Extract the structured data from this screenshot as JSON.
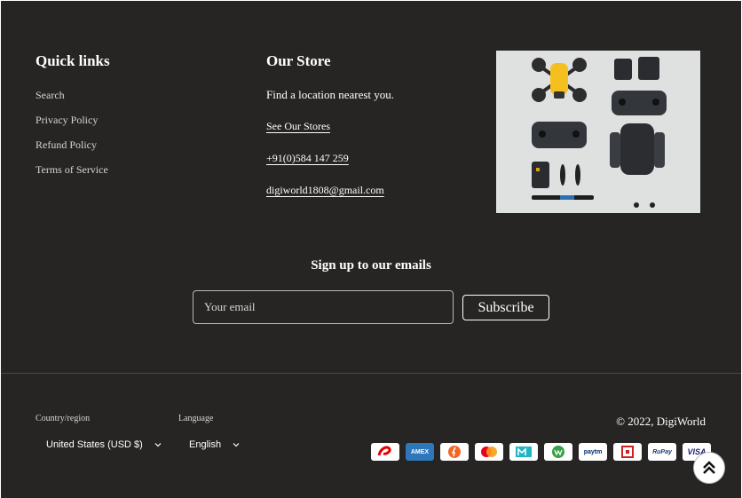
{
  "quick_links": {
    "title": "Quick links",
    "items": [
      {
        "label": "Search"
      },
      {
        "label": "Privacy Policy"
      },
      {
        "label": "Refund Policy"
      },
      {
        "label": "Terms of Service"
      }
    ]
  },
  "store": {
    "title": "Our Store",
    "tagline": "Find a location nearest you.",
    "stores_link": "See Our Stores",
    "phone": "+91(0)584 147 259",
    "email": "digiworld1808@gmail.com"
  },
  "image": {
    "icon": "drone-kit-photo"
  },
  "newsletter": {
    "title": "Sign up to our emails",
    "email_placeholder": "Your email",
    "subscribe_label": "Subscribe"
  },
  "localization": {
    "country_label": "Country/region",
    "country_value": "United States (USD $)",
    "language_label": "Language",
    "language_value": "English"
  },
  "copyright": "© 2022, DigiWorld",
  "payment_methods": [
    {
      "name": "airtel-icon",
      "color": "#e40000"
    },
    {
      "name": "amex-icon",
      "color": "#2e77bb",
      "text": "AMEX"
    },
    {
      "name": "freecharge-icon",
      "color": "#f26722"
    },
    {
      "name": "mastercard-icon",
      "color": "#eb001b"
    },
    {
      "name": "mobikwik-icon",
      "color": "#21b5c3"
    },
    {
      "name": "olamoney-icon",
      "color": "#35a047"
    },
    {
      "name": "paytm-icon",
      "color": "#002e6e",
      "text": "paytm"
    },
    {
      "name": "jio-icon",
      "color": "#d22020"
    },
    {
      "name": "rupay-icon",
      "color": "#1b3c6d",
      "text": "RuPay"
    },
    {
      "name": "visa-icon",
      "color": "#1a1f71",
      "text": "VISA"
    }
  ],
  "colors": {
    "footer_bg": "#272424",
    "text": "#ffffff"
  }
}
